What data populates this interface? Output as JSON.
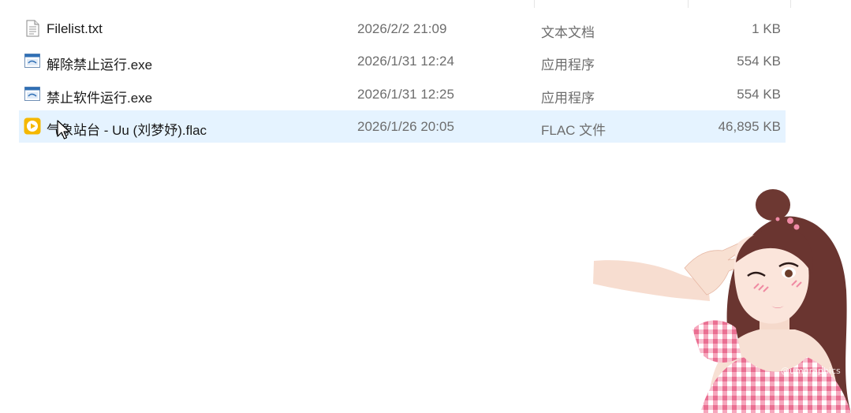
{
  "files": [
    {
      "name": "Filelist.txt",
      "date": "2026/2/2 21:09",
      "type": "文本文档",
      "size": "1 KB",
      "icon": "text-file-icon",
      "selected": false
    },
    {
      "name": "解除禁止运行.exe",
      "date": "2026/1/31 12:24",
      "type": "应用程序",
      "size": "554 KB",
      "icon": "application-icon",
      "selected": false
    },
    {
      "name": "禁止软件运行.exe",
      "date": "2026/1/31 12:25",
      "type": "应用程序",
      "size": "554 KB",
      "icon": "application-icon",
      "selected": false
    },
    {
      "name": "气象站台 - Uu (刘梦妤).flac",
      "date": "2026/1/26 20:05",
      "type": "FLAC 文件",
      "size": "46,895 KB",
      "icon": "audio-file-icon",
      "selected": true
    }
  ],
  "wallpaper": {
    "watermark": "@umgraphics"
  },
  "colors": {
    "selection": "#e5f3ff",
    "secondary_text": "#6d6d6d",
    "audio_icon": "#f5b800"
  }
}
